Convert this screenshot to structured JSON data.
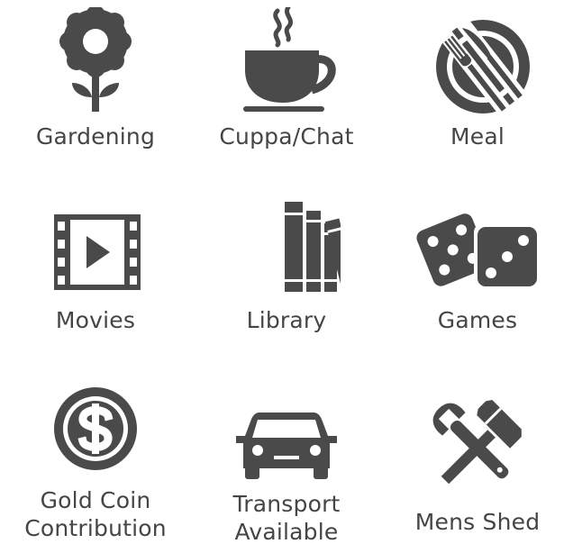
{
  "colors": {
    "icon": "#4a4a4a",
    "text": "#454545",
    "background": "#ffffff"
  },
  "activities": [
    {
      "label": "Gardening",
      "icon": "flower-icon"
    },
    {
      "label": "Cuppa/Chat",
      "icon": "coffee-cup-icon"
    },
    {
      "label": "Meal",
      "icon": "plate-fork-knife-icon"
    },
    {
      "label": "Movies",
      "icon": "film-play-icon"
    },
    {
      "label": "Library",
      "icon": "books-icon"
    },
    {
      "label": "Games",
      "icon": "dice-icon"
    },
    {
      "label": "Gold Coin\nContribution",
      "icon": "dollar-coin-icon"
    },
    {
      "label": "Transport\nAvailable",
      "icon": "car-icon"
    },
    {
      "label": "Mens Shed",
      "icon": "tools-icon"
    }
  ]
}
